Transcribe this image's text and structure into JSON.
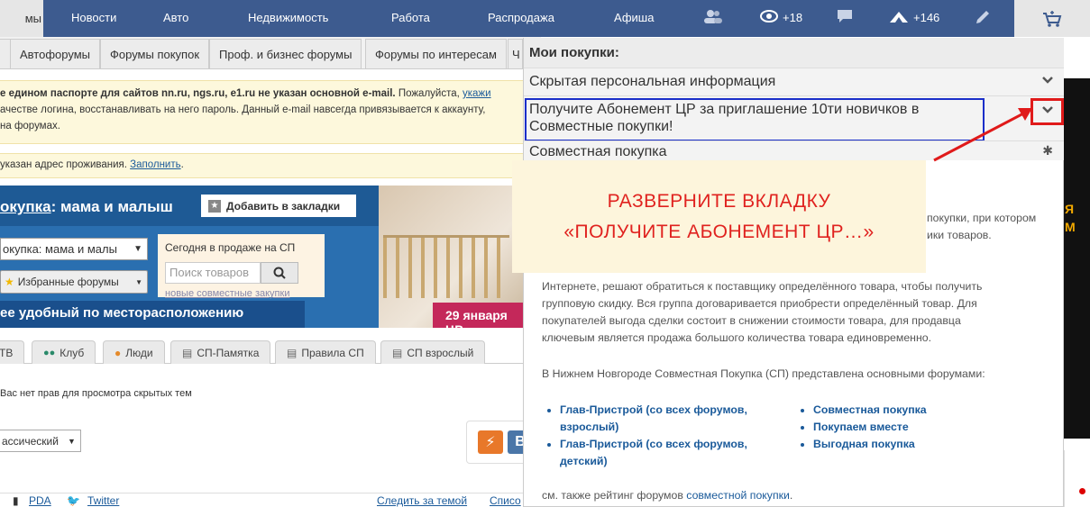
{
  "topnav": {
    "first_partial": "мы",
    "items": [
      "Новости",
      "Авто",
      "Недвижимость",
      "Работа",
      "Распродажа",
      "Афиша"
    ],
    "views_count": "+18",
    "rating_count": "+146"
  },
  "forum_tabs": [
    "Автофорумы",
    "Форумы покупок",
    "Проф. и бизнес форумы",
    "Форумы по интересам",
    "Ч"
  ],
  "notice_email": {
    "bold": "е едином паспорте для сайтов nn.ru, ngs.ru, e1.ru не указан основной e-mail.",
    "normal": " Пожалуйста, ",
    "link": "укажи",
    "line2": "ачестве логина, восстанавливать на него пароль. Данный e-mail навсегда привязывается к аккаунту,",
    "line3": "на форумах."
  },
  "notice_address": {
    "text": "указан адрес проживания. ",
    "link": "Заполнить",
    "end": "."
  },
  "banner": {
    "title_link": "окупка",
    "title_rest": ": мама и малыш",
    "bookmark_label": "Добавить в закладки",
    "select_forum": "окупка: мама и малы",
    "fav_forums": "Избранные форумы",
    "today_label": "Сегодня в продаже на СП",
    "search_placeholder": "Поиск товаров",
    "new_purchases_link": "новые совместные закупки",
    "bottom_text": "ее удобный по месторасположению",
    "date_text": "29 января ЦР"
  },
  "subtabs": [
    "ТВ",
    "Клуб",
    "Люди",
    "СП-Памятка",
    "Правила СП",
    "СП взрослый"
  ],
  "no_permission": "Вас нет прав для просмотра скрытых тем",
  "view_select": "ассический",
  "footer": {
    "pda": "PDA",
    "twitter": "Twitter",
    "follow": "Следить за темой",
    "list_partial": "Списо"
  },
  "right_ad_text": "Я\nМ",
  "panel": {
    "header": "Мои покупки:",
    "accordion": [
      "Скрытая персональная информация",
      "Получите Абонемент ЦР за приглашение 10ти новичков в Совместные покупки!",
      "Совместная покупка"
    ],
    "overlay_line1": "РАЗВЕРНИТЕ ВКЛАДКУ",
    "overlay_line2": "«ПОЛУЧИТЕ АБОНЕМЕНТ ЦР…»",
    "right_frag1": "покупки, при котором",
    "right_frag2": "ики товаров.",
    "para1_line1": "Интернете, решают обратиться к поставщику определённого товара, чтобы получить",
    "para1_line2": "групповую скидку. Вся группа договаривается приобрести определённый товар. Для",
    "para1_line3": "покупателей выгода сделки состоит в снижении стоимости товара, для продавца",
    "para1_line4": "ключевым является продажа большого количества товара единовременно.",
    "para2": "В Нижнем Новгороде Совместная Покупка (СП) представлена основными форумами:",
    "list_left": [
      "Глав-Пристрой (со всех форумов, взрослый)",
      "Глав-Пристрой (со всех форумов, детский)"
    ],
    "list_right": [
      "Совместная покупка",
      "Покупаем вместе",
      "Выгодная покупка"
    ],
    "see_also": "см. также рейтинг форумов ",
    "see_also_link": "совместной покупки",
    "see_also_end": "."
  }
}
